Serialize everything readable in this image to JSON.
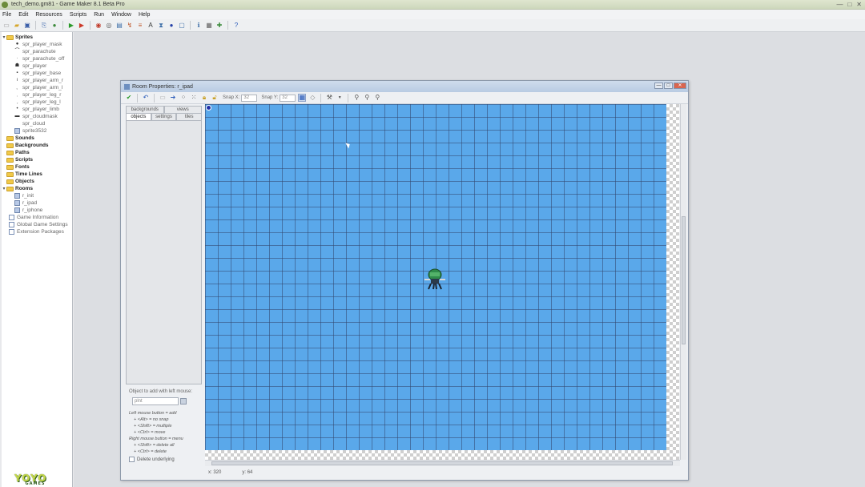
{
  "window": {
    "title": "tech_demo.gm81 - Game Maker 8.1 Beta Pro",
    "controls": [
      "—",
      "□",
      "✕"
    ]
  },
  "menu": [
    "File",
    "Edit",
    "Resources",
    "Scripts",
    "Run",
    "Window",
    "Help"
  ],
  "toolbar_icons": [
    "new-file-icon",
    "open-folder-icon",
    "save-icon",
    "export-icon",
    "globe-icon",
    "run-icon",
    "debug-run-icon",
    "add-sprite-icon",
    "add-sound-icon",
    "add-background-icon",
    "add-path-icon",
    "add-script-icon",
    "add-font-icon",
    "add-timeline-icon",
    "add-object-icon",
    "add-room-icon",
    "game-info-icon",
    "settings-icon",
    "extension-icon",
    "help-icon"
  ],
  "tree": {
    "sprites_label": "Sprites",
    "sprites": [
      "spr_player_mask",
      "spr_parachute",
      "spr_parachute_off",
      "spr_player",
      "spr_player_base",
      "spr_player_arm_r",
      "spr_player_arm_l",
      "spr_player_leg_r",
      "spr_player_leg_l",
      "spr_player_limb",
      "spr_cloudmask",
      "spr_cloud",
      "sprite3532"
    ],
    "groups": [
      "Sounds",
      "Backgrounds",
      "Paths",
      "Scripts",
      "Fonts",
      "Time Lines",
      "Objects"
    ],
    "rooms_label": "Rooms",
    "rooms": [
      "r_init",
      "r_ipad",
      "r_iphone"
    ],
    "extras": [
      "Game Information",
      "Global Game Settings",
      "Extension Packages"
    ]
  },
  "logo": {
    "text": "YOYO",
    "sub": "GAMES"
  },
  "room_window": {
    "title": "Room Properties: r_ipad",
    "snap_x_label": "Snap X:",
    "snap_x_value": "32",
    "snap_y_label": "Snap Y:",
    "snap_y_value": "32",
    "tabs_top": [
      "backgrounds",
      "views"
    ],
    "tabs_bottom": [
      "objects",
      "settings",
      "tiles"
    ],
    "object_label": "Object to add with left mouse:",
    "object_value": "plnt",
    "instructions": [
      "Left mouse button = add",
      "+ <Alt> = no snap",
      "+ <Shift> = multiple",
      "+ <Ctrl> = move",
      "Right mouse button = menu",
      "+ <Shift> = delete all",
      "+ <Ctrl> = delete"
    ],
    "delete_underlying": "Delete underlying",
    "status_x": "x: 320",
    "status_y": "y: 64"
  },
  "colors": {
    "room_background": "#5aa8ea",
    "grid": "#32466e"
  }
}
